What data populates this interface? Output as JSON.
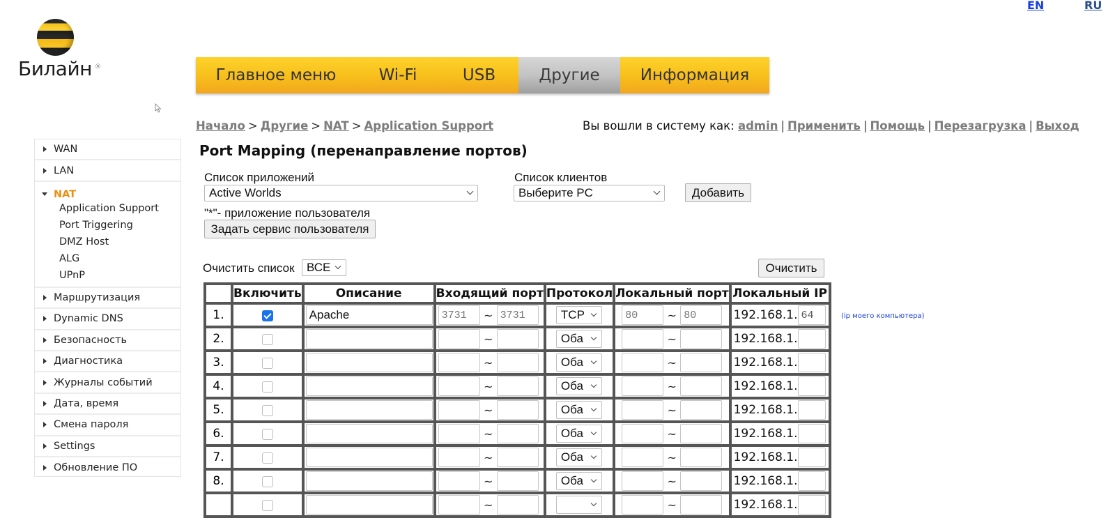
{
  "languages": [
    {
      "label": "EN",
      "color": "#1a3fe0"
    },
    {
      "label": "RU",
      "color": "#2a4f8a"
    }
  ],
  "brand": {
    "name": "Билайн",
    "registered": "®"
  },
  "top_nav": {
    "tabs": [
      {
        "label": "Главное меню",
        "active": false
      },
      {
        "label": "Wi-Fi",
        "active": false
      },
      {
        "label": "USB",
        "active": false
      },
      {
        "label": "Другие",
        "active": true
      },
      {
        "label": "Информация",
        "active": false
      }
    ]
  },
  "breadcrumb": [
    "Начало",
    "Другие",
    "NAT",
    "Application Support"
  ],
  "userbar": {
    "prefix": "Вы вошли в систему как:",
    "user": "admin",
    "links": [
      "Применить",
      "Помощь",
      "Перезагрузка",
      "Выход"
    ]
  },
  "sidebar": {
    "items_before": [
      {
        "label": "WAN"
      },
      {
        "label": "LAN"
      }
    ],
    "group": {
      "label": "NAT",
      "accent": "#e8900f",
      "children": [
        "Application Support",
        "Port Triggering",
        "DMZ Host",
        "ALG",
        "UPnP"
      ]
    },
    "items_after": [
      {
        "label": "Маршрутизация"
      },
      {
        "label": "Dynamic DNS"
      },
      {
        "label": "Безопасность"
      },
      {
        "label": "Диагностика"
      },
      {
        "label": "Журналы событий"
      },
      {
        "label": "Дата, время"
      },
      {
        "label": "Смена пароля"
      },
      {
        "label": "Settings"
      },
      {
        "label": "Обновление ПО"
      }
    ]
  },
  "page": {
    "title": "Port Mapping (перенаправление портов)",
    "app_list_label": "Список приложений",
    "app_list_value": "Active Worlds",
    "client_list_label": "Список клиентов",
    "client_list_value": "Выберите PC",
    "add_button": "Добавить",
    "user_app_note": "\"*\"- приложение пользователя",
    "user_service_button": "Задать сервис пользователя",
    "clear_list_label": "Очистить список",
    "clear_list_value": "ВСЕ",
    "clear_button": "Очистить",
    "ip_hint": "(ip моего компьютера)"
  },
  "table": {
    "headers": [
      "",
      "Включить",
      "Описание",
      "Входящий порт",
      "Протокол",
      "Локальный порт",
      "Локальный IP"
    ],
    "ip_prefix": "192.168.1.",
    "range_sep": "~",
    "rows": [
      {
        "num": "1.",
        "enabled": true,
        "desc": "Apache",
        "in_from": "3731",
        "in_to": "3731",
        "proto": "TCP",
        "loc_from": "80",
        "loc_to": "80",
        "ip_last": "64"
      },
      {
        "num": "2.",
        "enabled": false,
        "desc": "",
        "in_from": "",
        "in_to": "",
        "proto": "Оба",
        "loc_from": "",
        "loc_to": "",
        "ip_last": ""
      },
      {
        "num": "3.",
        "enabled": false,
        "desc": "",
        "in_from": "",
        "in_to": "",
        "proto": "Оба",
        "loc_from": "",
        "loc_to": "",
        "ip_last": ""
      },
      {
        "num": "4.",
        "enabled": false,
        "desc": "",
        "in_from": "",
        "in_to": "",
        "proto": "Оба",
        "loc_from": "",
        "loc_to": "",
        "ip_last": ""
      },
      {
        "num": "5.",
        "enabled": false,
        "desc": "",
        "in_from": "",
        "in_to": "",
        "proto": "Оба",
        "loc_from": "",
        "loc_to": "",
        "ip_last": ""
      },
      {
        "num": "6.",
        "enabled": false,
        "desc": "",
        "in_from": "",
        "in_to": "",
        "proto": "Оба",
        "loc_from": "",
        "loc_to": "",
        "ip_last": ""
      },
      {
        "num": "7.",
        "enabled": false,
        "desc": "",
        "in_from": "",
        "in_to": "",
        "proto": "Оба",
        "loc_from": "",
        "loc_to": "",
        "ip_last": ""
      },
      {
        "num": "8.",
        "enabled": false,
        "desc": "",
        "in_from": "",
        "in_to": "",
        "proto": "Оба",
        "loc_from": "",
        "loc_to": "",
        "ip_last": ""
      },
      {
        "num": "",
        "enabled": false,
        "desc": "",
        "in_from": "",
        "in_to": "",
        "proto": "",
        "loc_from": "",
        "loc_to": "",
        "ip_last": ""
      }
    ]
  }
}
